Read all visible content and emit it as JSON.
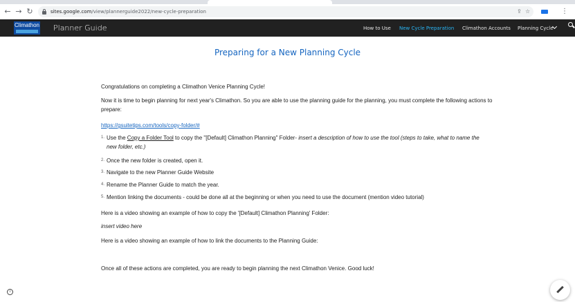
{
  "browser": {
    "url_host": "sites.google.com",
    "url_path": "/view/plannerguide2022/new-cycle-preparation",
    "back_glyph": "←",
    "forward_glyph": "→",
    "reload_glyph": "↻",
    "share_glyph": "⇪",
    "star_glyph": "☆",
    "more_glyph": "⋮"
  },
  "site": {
    "logo_text": "Climathon",
    "title": "Planner Guide",
    "nav": [
      {
        "label": "How to Use"
      },
      {
        "label": "New Cycle Preparation"
      },
      {
        "label": "Climathon Accounts"
      },
      {
        "label": "Planning Cycle"
      }
    ]
  },
  "page": {
    "heading": "Preparing for a New Planning Cycle",
    "p1": "Congratulations on completing a Climathon Venice Planning Cycle!",
    "p2": "Now it is time to begin planning for next year's Climathon. So you are able to use the planning guide for the planning, you must complete the following actions to prepare:",
    "link": "https://gsuitetips.com/tools/copy-folder/#",
    "list": [
      {
        "num": "1.",
        "pre": "Use the ",
        "link": "Copy a Folder Tool",
        "post": " to copy the \"[Default] Climathon Planning\" Folder- ",
        "italic": "insert a description of how to use the tool (steps to take, what to name the new folder, etc.)"
      },
      {
        "num": "2.",
        "text": "Once the new folder is created, open it."
      },
      {
        "num": "3.",
        "text": "Navigate to the new Planner Guide Website"
      },
      {
        "num": "4.",
        "text": "Rename the Planner Guide to match the year."
      },
      {
        "num": "5.",
        "text": "Mention linking the documents - could be done all at the beginning or when you need to use the document (mention video tutorial)"
      }
    ],
    "p3": "Here is a video showing an example of how to copy the '[Default] Climathon Planning' Folder:",
    "p4": "insert video here",
    "p5": "Here is a video showing an example of how to link the documents to the Planning Guide:",
    "p6": "Once all of these actions are completed, you are ready to begin planning the next Climathon Venice. Good luck!"
  },
  "footer": {
    "info_glyph": "i"
  }
}
